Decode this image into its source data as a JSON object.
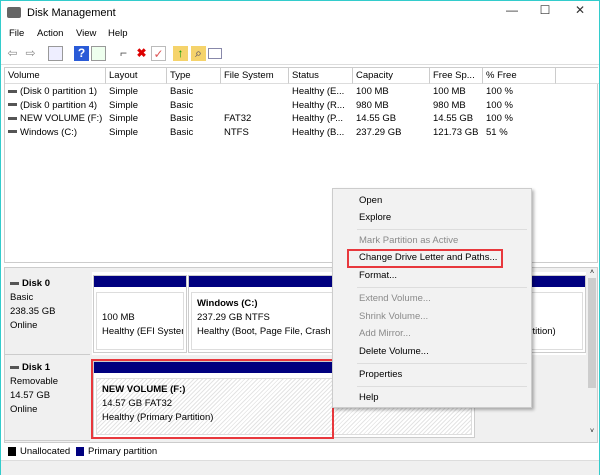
{
  "window": {
    "title": "Disk Management",
    "minimize": "—",
    "maximize": "☐",
    "close": "✕"
  },
  "menubar": [
    "File",
    "Action",
    "View",
    "Help"
  ],
  "toolbar": [
    "back-icon",
    "forward-icon",
    "console-tree-icon",
    "help-icon",
    "properties-pane-icon",
    "connect-icon",
    "delete-icon",
    "check-icon",
    "folder-up-icon",
    "folder-search-icon",
    "list-icon"
  ],
  "table": {
    "headers": [
      "Volume",
      "Layout",
      "Type",
      "File System",
      "Status",
      "Capacity",
      "Free Sp...",
      "% Free"
    ],
    "rows": [
      [
        "(Disk 0 partition 1)",
        "Simple",
        "Basic",
        "",
        "Healthy (E...",
        "100 MB",
        "100 MB",
        "100 %"
      ],
      [
        "(Disk 0 partition 4)",
        "Simple",
        "Basic",
        "",
        "Healthy (R...",
        "980 MB",
        "980 MB",
        "100 %"
      ],
      [
        "NEW VOLUME (F:)",
        "Simple",
        "Basic",
        "FAT32",
        "Healthy (P...",
        "14.55 GB",
        "14.55 GB",
        "100 %"
      ],
      [
        "Windows (C:)",
        "Simple",
        "Basic",
        "NTFS",
        "Healthy (B...",
        "237.29 GB",
        "121.73 GB",
        "51 %"
      ]
    ]
  },
  "disks": [
    {
      "name": "Disk 0",
      "type": "Basic",
      "size": "238.35 GB",
      "status": "Online",
      "partitions": [
        {
          "title": "",
          "size": "100 MB",
          "health": "Healthy (EFI System"
        },
        {
          "title": "Windows  (C:)",
          "size": "237.29 GB NTFS",
          "health": "Healthy (Boot, Page File, Crash D"
        },
        {
          "title": "",
          "size": "",
          "health": "artition)"
        }
      ]
    },
    {
      "name": "Disk 1",
      "type": "Removable",
      "size": "14.57 GB",
      "status": "Online",
      "partitions": [
        {
          "title": "NEW VOLUME  (F:)",
          "size": "14.57 GB FAT32",
          "health": "Healthy (Primary Partition)"
        }
      ]
    }
  ],
  "legend": [
    {
      "label": "Unallocated",
      "color": "#000000"
    },
    {
      "label": "Primary partition",
      "color": "#00007f"
    }
  ],
  "context_menu": {
    "items": [
      {
        "label": "Open",
        "enabled": true
      },
      {
        "label": "Explore",
        "enabled": true
      },
      {
        "label": "Mark Partition as Active",
        "enabled": false
      },
      {
        "label": "Change Drive Letter and Paths...",
        "enabled": true,
        "highlighted": true
      },
      {
        "label": "Format...",
        "enabled": true
      },
      {
        "label": "Extend Volume...",
        "enabled": false
      },
      {
        "label": "Shrink Volume...",
        "enabled": false
      },
      {
        "label": "Add Mirror...",
        "enabled": false
      },
      {
        "label": "Delete Volume...",
        "enabled": true
      },
      {
        "label": "Properties",
        "enabled": true
      },
      {
        "label": "Help",
        "enabled": true
      }
    ]
  },
  "colors": {
    "primary_partition": "#00007f",
    "highlight": "#e8383d"
  }
}
